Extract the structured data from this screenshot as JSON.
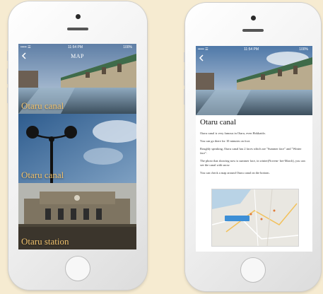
{
  "left_phone": {
    "status": {
      "carrier": "••••• ☰",
      "time": "11:54 PM",
      "battery": "100%"
    },
    "nav": {
      "title": "MAP",
      "back_icon": "chevron-left-icon"
    },
    "items": [
      {
        "label": "Otaru canal"
      },
      {
        "label": "Otaru canal"
      },
      {
        "label": "Otaru station"
      }
    ]
  },
  "right_phone": {
    "status": {
      "carrier": "••••• ☰",
      "time": "11:54 PM",
      "battery": "100%"
    },
    "nav": {
      "back_icon": "chevron-left-icon"
    },
    "detail": {
      "title": "Otaru canal",
      "paragraphs": [
        "Otaru canal is very famous in Otaru, even Hokkaido.",
        "You can go there for 10 minutes on foot.",
        "Roughly speaking, Otaru canal has 2 faces which are \"Summer face\" and \"Winter face\".",
        "The photo that showing now is summer face, in winter(Novem- ber-March), you can see the canal with snow.",
        "You can check a map around Otaru canal on the bottom."
      ]
    }
  },
  "colors": {
    "label_gold": "#f0c26e",
    "map_pin": "#3d8fd6",
    "background": "#f6ebd1"
  }
}
